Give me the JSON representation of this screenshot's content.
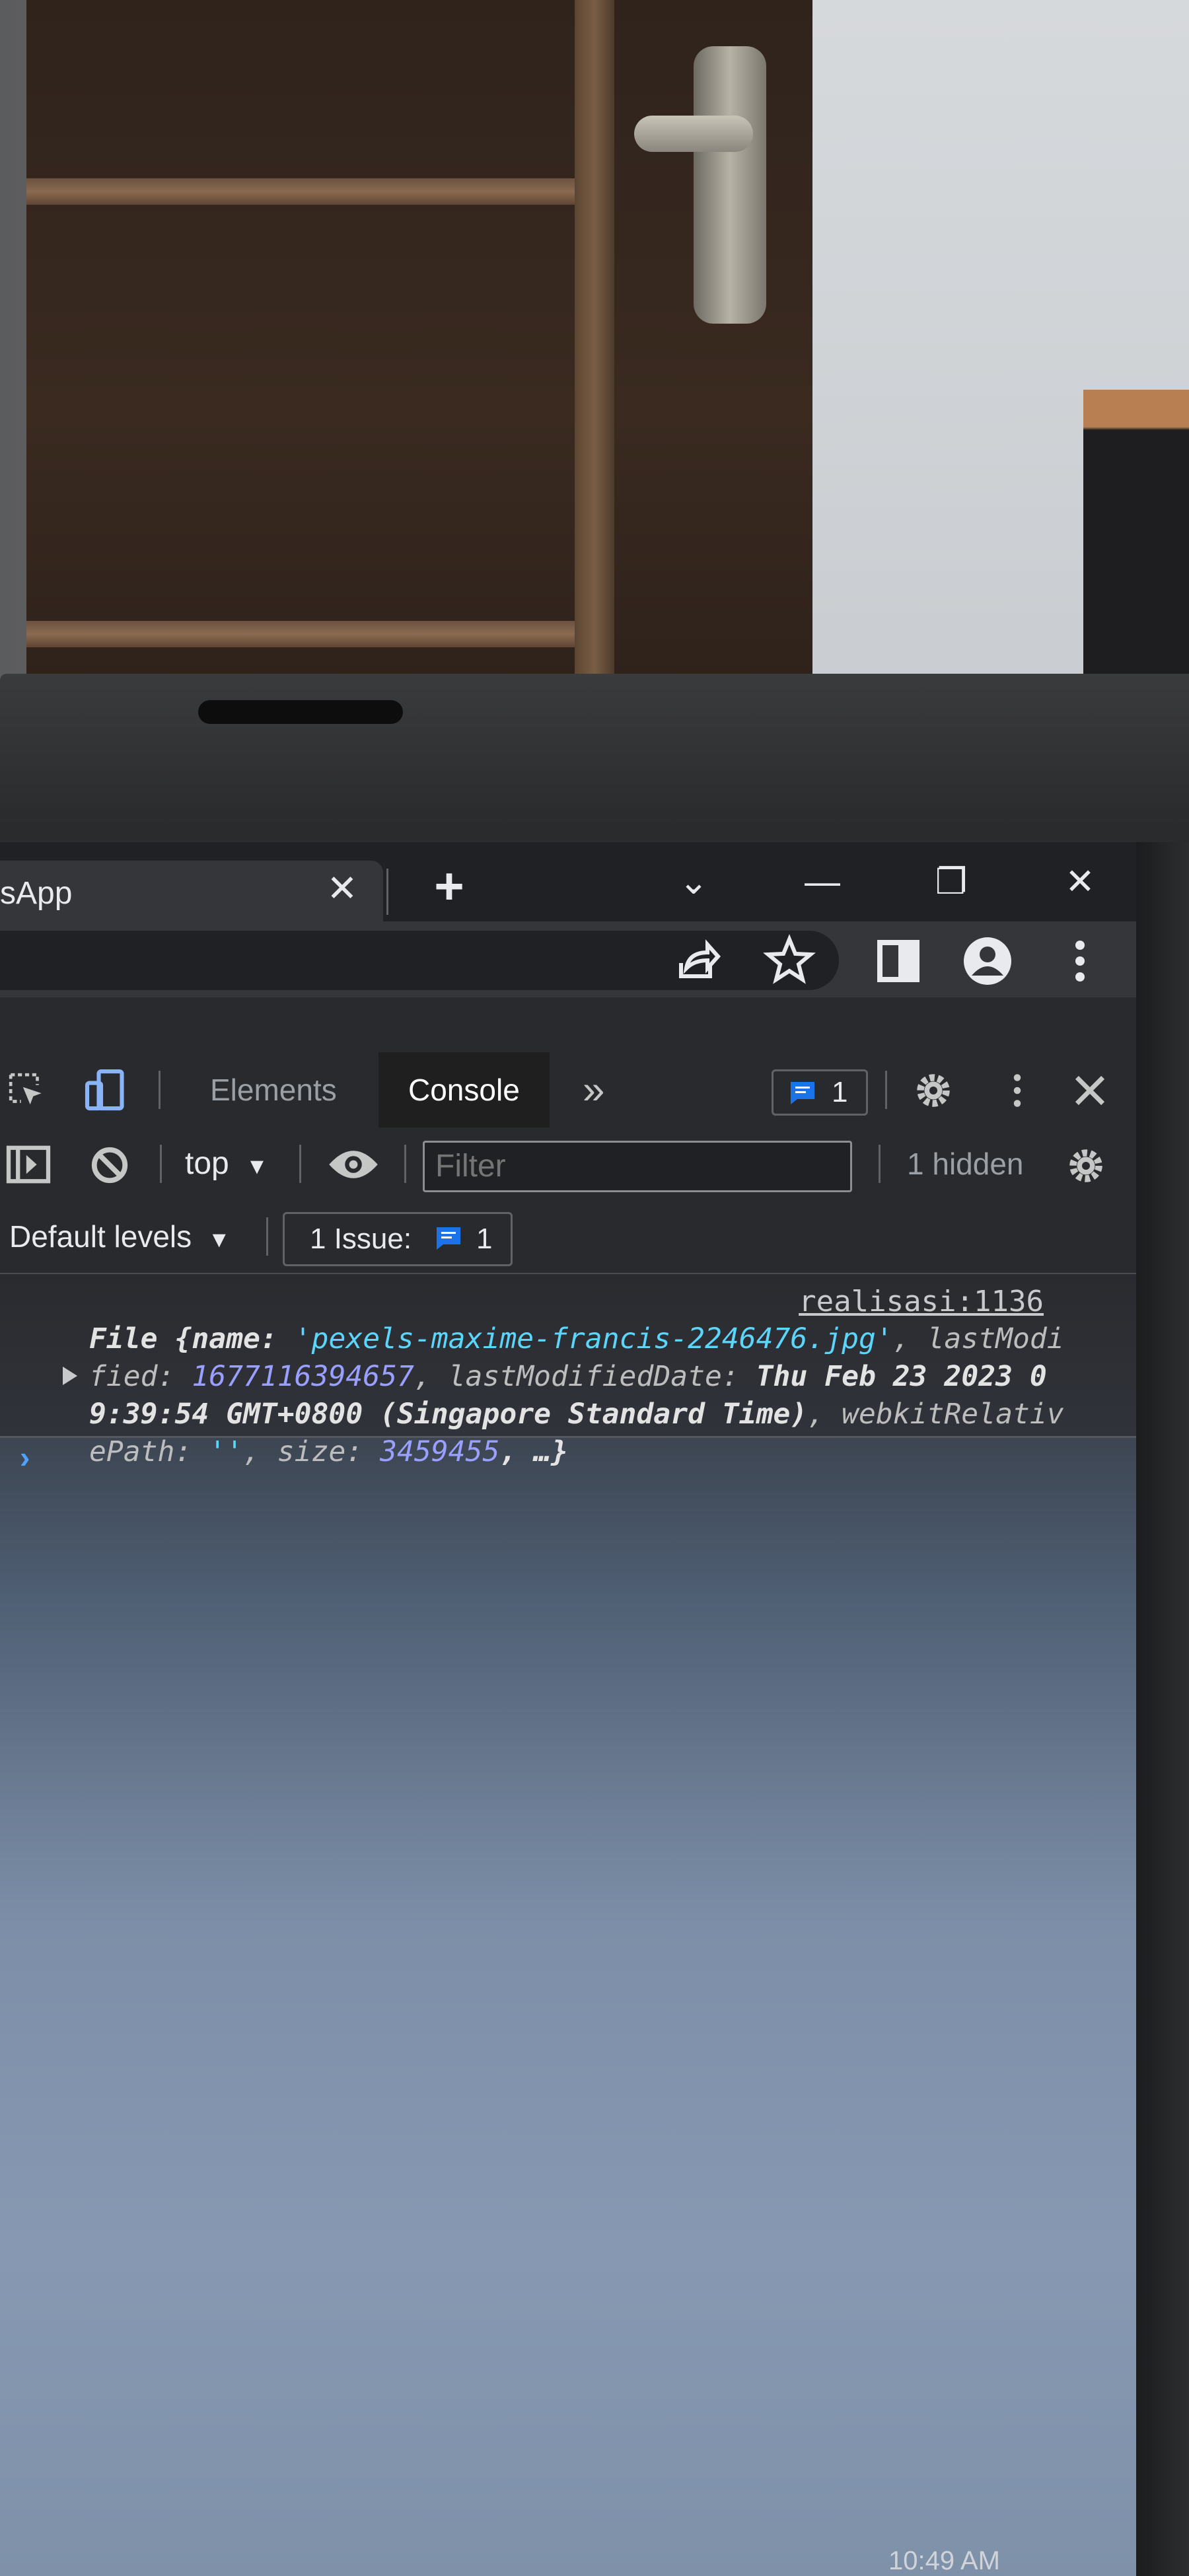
{
  "browser": {
    "tab_title": "sApp",
    "tab_close_glyph": "✕",
    "new_tab_glyph": "+",
    "tab_search_glyph": "⌄",
    "minimize_glyph": "—",
    "restore_glyph": "❐",
    "close_glyph": "✕"
  },
  "devtools": {
    "tabs": [
      "Elements",
      "Console"
    ],
    "more_tabs_glyph": "»",
    "issues_count": "1",
    "context_label": "top",
    "filter_placeholder": "Filter",
    "hidden_label": "1 hidden",
    "levels_label": "Default levels",
    "issue_button_label": "1 Issue:",
    "issue_button_count": "1"
  },
  "console": {
    "source_link": "realisasi:1136",
    "log_prefix": "File {name: ",
    "file_name": "'pexels-maxime-francis-2246476.jpg'",
    "sep1": ", lastModified: ",
    "last_modified": "1677116394657",
    "sep2": ", lastModifiedDate: ",
    "last_modified_date": "Thu Feb 23 2023 09:39:54 GMT+0800 (Singapore Standard Time)",
    "sep3": ", webkitRelativePath: ",
    "relative_path": "''",
    "sep4": ", size: ",
    "size": "3459455",
    "suffix": ", …}",
    "prompt_glyph": "›"
  },
  "taskbar": {
    "clock": "10:49 AM"
  }
}
